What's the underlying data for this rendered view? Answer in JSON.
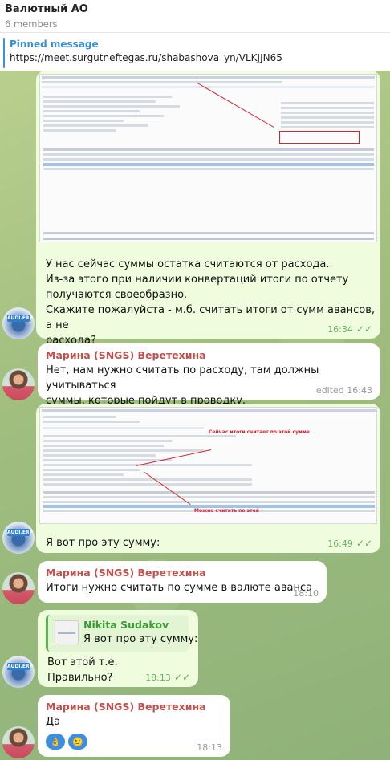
{
  "header": {
    "title": "Валютный АО",
    "members": "6 members"
  },
  "pinned": {
    "label": "Pinned message",
    "text": "https://meet.surgutneftegas.ru/shabashova_yn/VLKJJN65"
  },
  "messages": [
    {
      "type": "outgoing-photo",
      "text_lines": [
        "У нас сейчас суммы остатка считаются от расхода.",
        "Из-за этого при наличии конвертаций итоги по отчету",
        "получаются своеобразно.",
        "Скажите пожалуйста - м.б. считать итоги от сумм авансов, а не",
        "расхода?"
      ],
      "time": "16:34"
    },
    {
      "type": "incoming",
      "sender": "Марина (SNGS) Веретехина",
      "text_lines": [
        "Нет, нам нужно считать по расходу, там должны учитываться",
        "суммы, которые пойдут в проводку."
      ],
      "time": "edited 16:43"
    },
    {
      "type": "outgoing-photo",
      "annotation_top": "Сейчас итоги считает по этой сумме",
      "annotation_bottom": "Можно считать по этой",
      "text": "Я вот про эту сумму:",
      "time": "16:49"
    },
    {
      "type": "incoming",
      "sender": "Марина (SNGS) Веретехина",
      "text": "Итоги нужно считать по сумме в валюте аванса",
      "time": "18:10"
    },
    {
      "type": "outgoing-reply",
      "quote_name": "Nikita Sudakov",
      "quote_text": "Я вот про эту сумму:",
      "text_lines": [
        "Вот этой т.е.",
        "Правильно?"
      ],
      "time": "18:13"
    },
    {
      "type": "incoming",
      "sender": "Марина (SNGS) Веретехина",
      "text": "Да",
      "reactions": [
        "👌",
        "🙂"
      ],
      "time": "18:13"
    }
  ]
}
